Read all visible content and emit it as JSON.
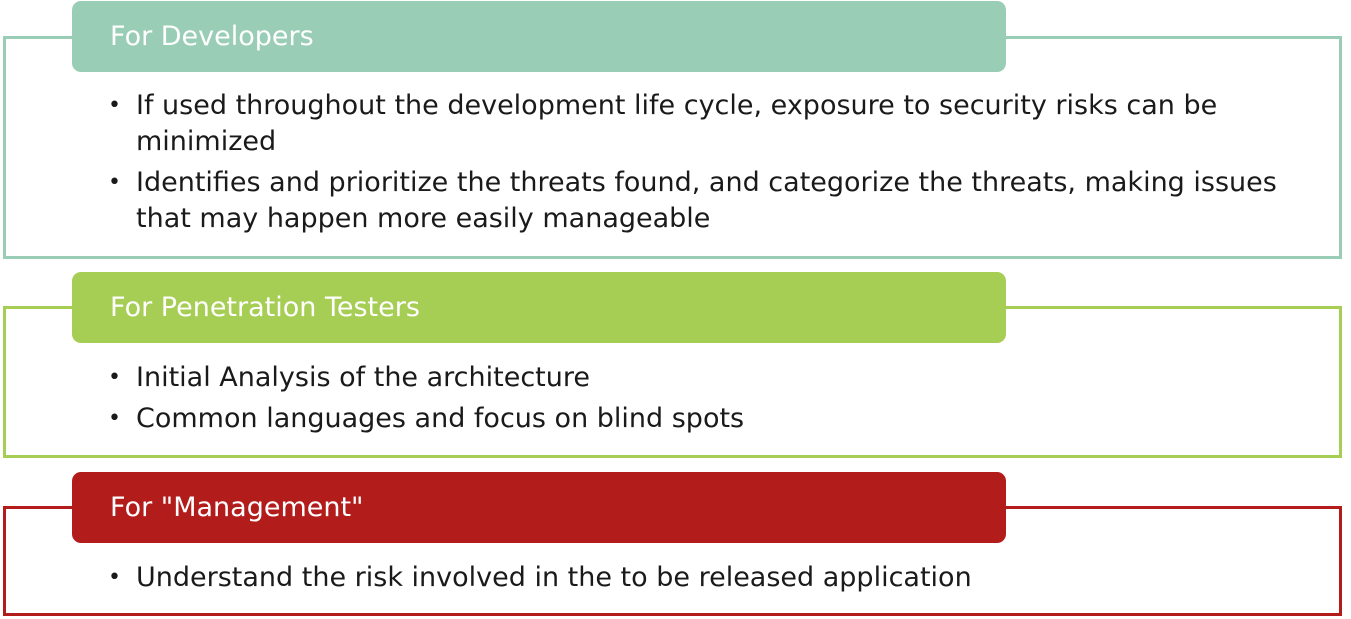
{
  "sections": [
    {
      "title": "For Developers",
      "color": "#99cdb5",
      "bullets": [
        "If used throughout the development life cycle, exposure to security risks can be minimized",
        "Identifies and prioritize the threats found, and categorize the threats, making issues that may happen more easily manageable"
      ]
    },
    {
      "title": "For Penetration Testers",
      "color": "#a6cd54",
      "bullets": [
        "Initial Analysis of the architecture",
        "Common languages and focus on blind spots"
      ]
    },
    {
      "title": "For \"Management\"",
      "color": "#b21d1c",
      "bullets": [
        "Understand the risk involved in the to be released application"
      ]
    }
  ]
}
